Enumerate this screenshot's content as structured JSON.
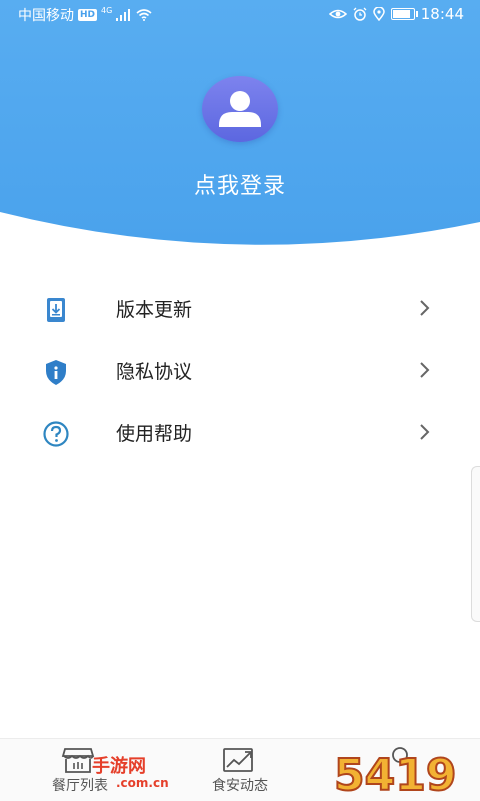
{
  "status_bar": {
    "carrier": "中国移动",
    "network_badge": "HD",
    "signal_type": "4G",
    "time": "18:44",
    "battery_level": 0.85
  },
  "profile": {
    "login_prompt": "点我登录"
  },
  "menu": {
    "items": [
      {
        "label": "版本更新",
        "icon": "download-icon"
      },
      {
        "label": "隐私协议",
        "icon": "shield-info-icon"
      },
      {
        "label": "使用帮助",
        "icon": "help-icon"
      }
    ]
  },
  "bottom_nav": {
    "items": [
      {
        "label": "餐厅列表",
        "icon": "storefront-icon"
      },
      {
        "label": "食安动态",
        "icon": "trend-chart-icon"
      },
      {
        "label": "",
        "icon": "profile-icon"
      }
    ]
  },
  "watermark": {
    "number": "5419",
    "text": "手游网",
    "domain": ".com.cn"
  },
  "colors": {
    "primary_blue": "#4ea6ee",
    "icon_blue": "#2f7ec8",
    "avatar_purple": "#6a72e6",
    "watermark_red": "#e53f2a"
  }
}
